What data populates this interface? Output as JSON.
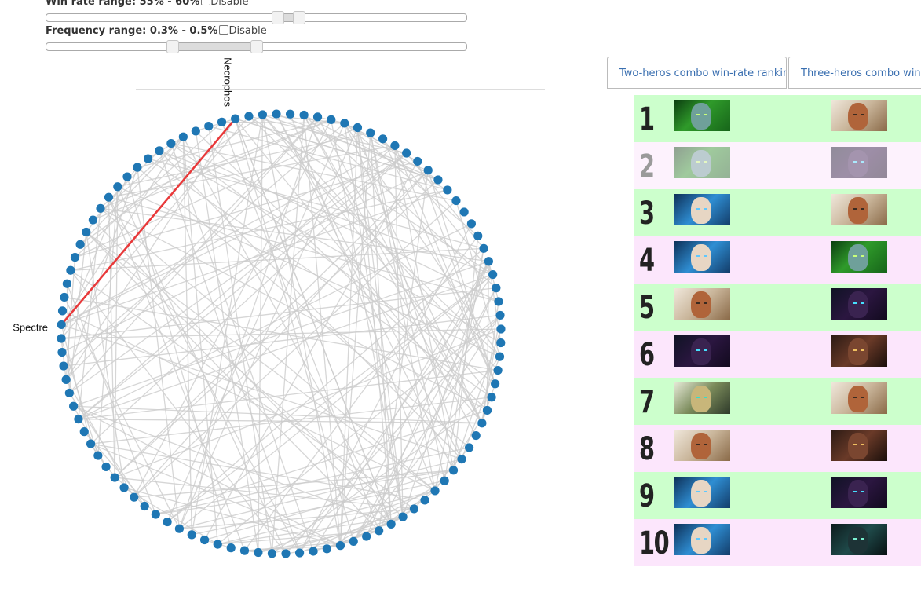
{
  "filters": {
    "win_rate": {
      "label": "Win rate range: 55% - 60%",
      "disable_label": "Disable",
      "disabled": false,
      "low_fraction": 0.55,
      "high_fraction": 0.6
    },
    "frequency": {
      "label": "Frequency range: 0.3% - 0.5%",
      "disable_label": "Disable",
      "disabled": false,
      "low_fraction": 0.3,
      "high_fraction": 0.5
    }
  },
  "graph": {
    "node_count": 100,
    "highlight_from": "Necrophos",
    "highlight_to": "Spectre",
    "node_color": "#1f77b4",
    "edge_color": "#cccccc",
    "highlight_color": "#e8393a"
  },
  "tabs": [
    {
      "label": "Two-heros combo win-rate ranking",
      "active": true
    },
    {
      "label": "Three-heros combo win-rate ranking",
      "active": false
    }
  ],
  "ranking": {
    "colors": {
      "odd": "#ccffcc",
      "even": "#fce6fc",
      "faded": "#fdf2fd"
    },
    "rows": [
      {
        "rank": "1",
        "hero_a": "necrophos-portrait",
        "hero_b": "omniknight-portrait",
        "faded": false
      },
      {
        "rank": "2",
        "hero_a": "necrophos-portrait",
        "hero_b": "spectre-portrait",
        "faded": true
      },
      {
        "rank": "3",
        "hero_a": "zeus-portrait",
        "hero_b": "omniknight-portrait",
        "faded": false
      },
      {
        "rank": "4",
        "hero_a": "zeus-portrait",
        "hero_b": "necrophos-portrait",
        "faded": false
      },
      {
        "rank": "5",
        "hero_a": "omniknight-portrait",
        "hero_b": "spectre-portrait",
        "faded": false
      },
      {
        "rank": "6",
        "hero_a": "spectre-portrait",
        "hero_b": "ursa-portrait",
        "faded": false
      },
      {
        "rank": "7",
        "hero_a": "skywrath-portrait",
        "hero_b": "omniknight-portrait",
        "faded": false
      },
      {
        "rank": "8",
        "hero_a": "omniknight-portrait",
        "hero_b": "ursa-portrait",
        "faded": false
      },
      {
        "rank": "9",
        "hero_a": "zeus-portrait",
        "hero_b": "spectre-portrait",
        "faded": false
      },
      {
        "rank": "10",
        "hero_a": "zeus-portrait",
        "hero_b": "abaddon-portrait",
        "faded": false
      }
    ]
  }
}
